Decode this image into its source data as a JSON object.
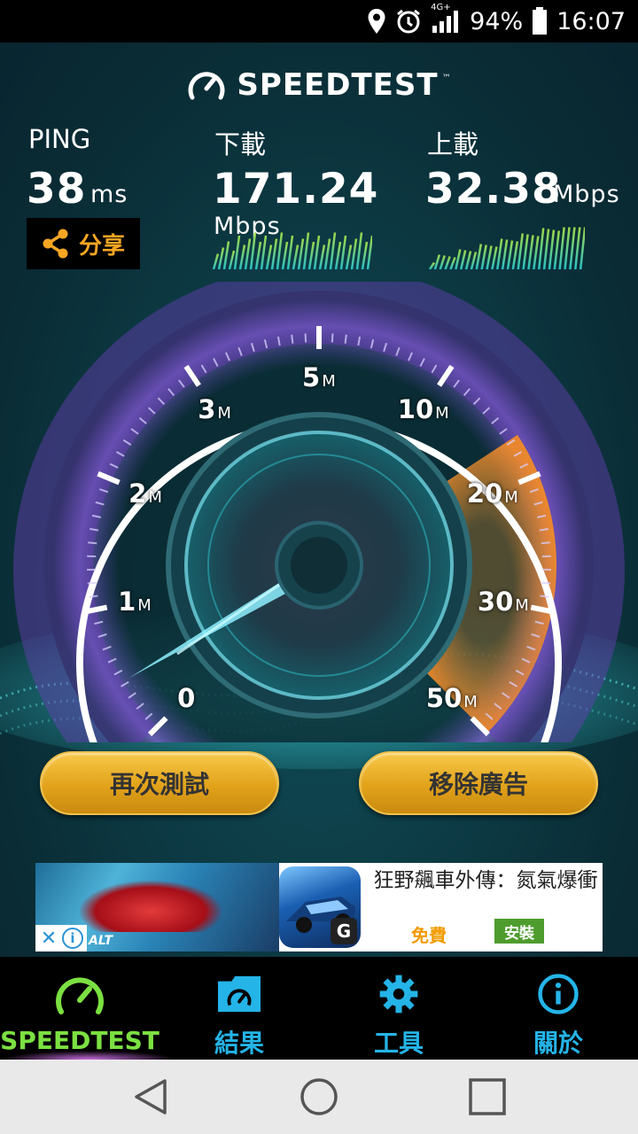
{
  "status_bar": {
    "network": "4G+",
    "battery": "94%",
    "time": "16:07"
  },
  "app": {
    "logo_text": "SPEEDTEST",
    "logo_tm": "™"
  },
  "ping": {
    "label": "PING",
    "value": "38",
    "unit": "ms"
  },
  "download": {
    "label": "下載",
    "value": "171.24",
    "unit": "Mbps"
  },
  "upload": {
    "label": "上載",
    "value": "32.38",
    "unit": "Mbps"
  },
  "share_button": {
    "label": "分享"
  },
  "gauge": {
    "labels": [
      {
        "num": "0",
        "unit": ""
      },
      {
        "num": "1",
        "unit": "M"
      },
      {
        "num": "2",
        "unit": "M"
      },
      {
        "num": "3",
        "unit": "M"
      },
      {
        "num": "5",
        "unit": "M"
      },
      {
        "num": "10",
        "unit": "M"
      },
      {
        "num": "20",
        "unit": "M"
      },
      {
        "num": "30",
        "unit": "M"
      },
      {
        "num": "50",
        "unit": "M"
      }
    ],
    "colors": {
      "arc": "#ffffff",
      "glow": "#b07cff",
      "high_zone": "#f08a2a",
      "needle": "#8ff0ff"
    }
  },
  "buttons": {
    "retest": "再次測試",
    "remove_ads": "移除廣告"
  },
  "ad": {
    "brand": "ALT",
    "title": "狂野飆車外傳：氮氣爆衝",
    "price": "免費",
    "install": "安裝",
    "g_logo": "G"
  },
  "bottom_nav": [
    {
      "label": "SPEEDTEST",
      "icon": "speedometer-icon"
    },
    {
      "label": "結果",
      "icon": "results-folder-icon"
    },
    {
      "label": "工具",
      "icon": "gear-icon"
    },
    {
      "label": "關於",
      "icon": "info-icon"
    }
  ],
  "system_nav": {
    "back": "back-icon",
    "home": "home-icon",
    "recents": "recents-icon"
  }
}
